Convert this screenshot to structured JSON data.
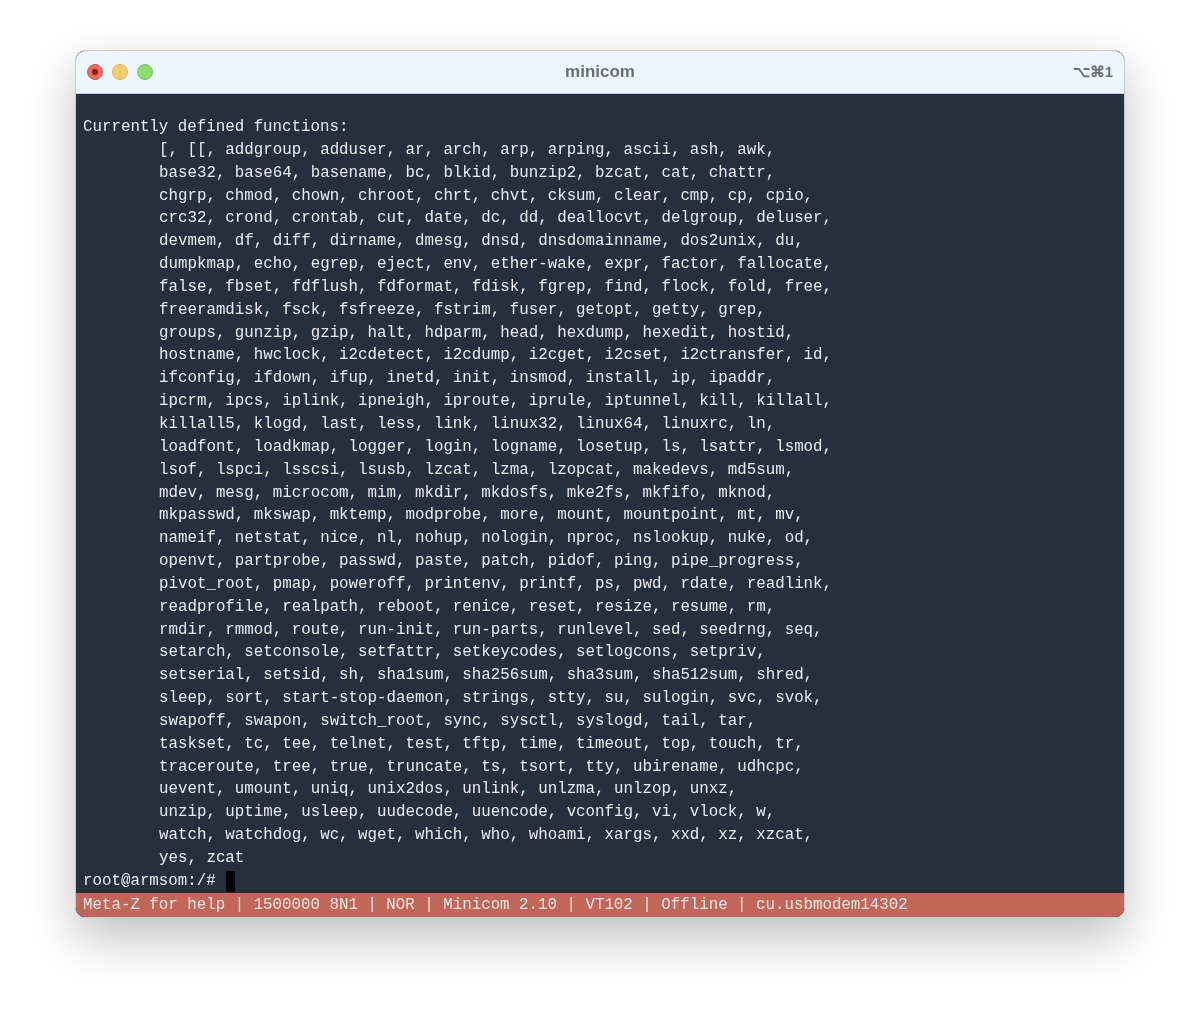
{
  "window": {
    "title": "minicom",
    "shortcut": "⌥⌘1"
  },
  "terminal": {
    "header": "Currently defined functions:",
    "function_lines": [
      "[, [[, addgroup, adduser, ar, arch, arp, arping, ascii, ash, awk,",
      "base32, base64, basename, bc, blkid, bunzip2, bzcat, cat, chattr,",
      "chgrp, chmod, chown, chroot, chrt, chvt, cksum, clear, cmp, cp, cpio,",
      "crc32, crond, crontab, cut, date, dc, dd, deallocvt, delgroup, deluser,",
      "devmem, df, diff, dirname, dmesg, dnsd, dnsdomainname, dos2unix, du,",
      "dumpkmap, echo, egrep, eject, env, ether-wake, expr, factor, fallocate,",
      "false, fbset, fdflush, fdformat, fdisk, fgrep, find, flock, fold, free,",
      "freeramdisk, fsck, fsfreeze, fstrim, fuser, getopt, getty, grep,",
      "groups, gunzip, gzip, halt, hdparm, head, hexdump, hexedit, hostid,",
      "hostname, hwclock, i2cdetect, i2cdump, i2cget, i2cset, i2ctransfer, id,",
      "ifconfig, ifdown, ifup, inetd, init, insmod, install, ip, ipaddr,",
      "ipcrm, ipcs, iplink, ipneigh, iproute, iprule, iptunnel, kill, killall,",
      "killall5, klogd, last, less, link, linux32, linux64, linuxrc, ln,",
      "loadfont, loadkmap, logger, login, logname, losetup, ls, lsattr, lsmod,",
      "lsof, lspci, lsscsi, lsusb, lzcat, lzma, lzopcat, makedevs, md5sum,",
      "mdev, mesg, microcom, mim, mkdir, mkdosfs, mke2fs, mkfifo, mknod,",
      "mkpasswd, mkswap, mktemp, modprobe, more, mount, mountpoint, mt, mv,",
      "nameif, netstat, nice, nl, nohup, nologin, nproc, nslookup, nuke, od,",
      "openvt, partprobe, passwd, paste, patch, pidof, ping, pipe_progress,",
      "pivot_root, pmap, poweroff, printenv, printf, ps, pwd, rdate, readlink,",
      "readprofile, realpath, reboot, renice, reset, resize, resume, rm,",
      "rmdir, rmmod, route, run-init, run-parts, runlevel, sed, seedrng, seq,",
      "setarch, setconsole, setfattr, setkeycodes, setlogcons, setpriv,",
      "setserial, setsid, sh, sha1sum, sha256sum, sha3sum, sha512sum, shred,",
      "sleep, sort, start-stop-daemon, strings, stty, su, sulogin, svc, svok,",
      "swapoff, swapon, switch_root, sync, sysctl, syslogd, tail, tar,",
      "taskset, tc, tee, telnet, test, tftp, time, timeout, top, touch, tr,",
      "traceroute, tree, true, truncate, ts, tsort, tty, ubirename, udhcpc,",
      "uevent, umount, uniq, unix2dos, unlink, unlzma, unlzop, unxz,",
      "unzip, uptime, usleep, uudecode, uuencode, vconfig, vi, vlock, w,",
      "watch, watchdog, wc, wget, which, who, whoami, xargs, xxd, xz, xzcat,",
      "yes, zcat"
    ],
    "prompt": "root@armsom:/#"
  },
  "status_bar": "Meta-Z for help | 1500000 8N1 | NOR | Minicom 2.10 | VT102 | Offline | cu.usbmodem14302"
}
